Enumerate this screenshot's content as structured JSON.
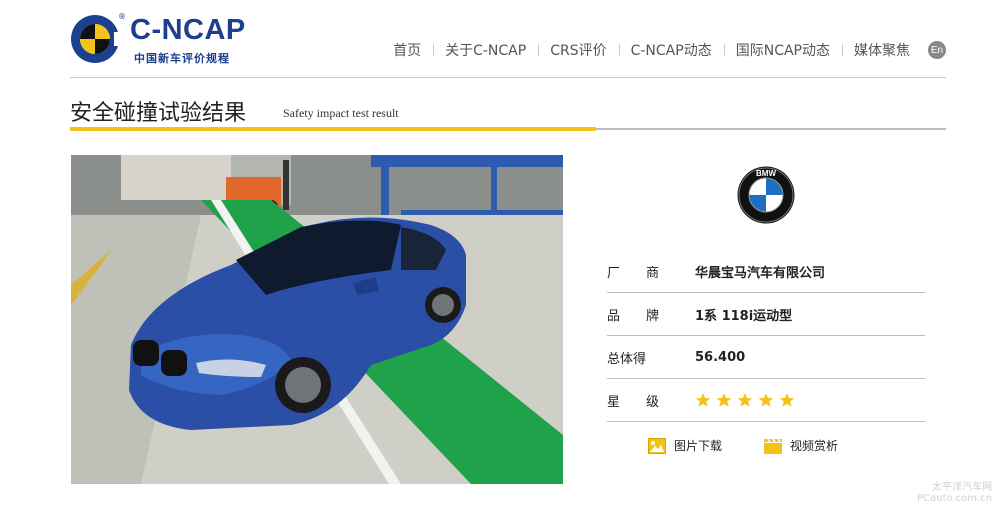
{
  "brand": {
    "name": "C-NCAP",
    "tagline": "中国新车评价规程",
    "reg_mark": "®"
  },
  "nav": {
    "items": [
      "首页",
      "关于C-NCAP",
      "CRS评价",
      "C-NCAP动态",
      "国际NCAP动态",
      "媒体聚焦"
    ],
    "lang_label": "En"
  },
  "page": {
    "title_zh": "安全碰撞试验结果",
    "title_en": "Safety impact test result"
  },
  "vehicle": {
    "brand_logo": "BMW",
    "rows": [
      {
        "label": "厂　　商",
        "value": "华晨宝马汽车有限公司"
      },
      {
        "label": "品　　牌",
        "value": "1系 118i运动型"
      },
      {
        "label": "总体得",
        "value": "56.400"
      },
      {
        "label": "星　　级",
        "value": ""
      }
    ],
    "star_rating": 5,
    "star_color": "#f3c31b"
  },
  "actions": {
    "photos_label": "图片下载",
    "video_label": "视频赏析"
  },
  "watermark": {
    "line1": "太平洋汽车网",
    "line2": "PCauto.com.cn"
  },
  "colors": {
    "brand_blue": "#1c3f8e",
    "accent_yellow": "#f3c31b",
    "rule_gray": "#bdbdbd"
  }
}
